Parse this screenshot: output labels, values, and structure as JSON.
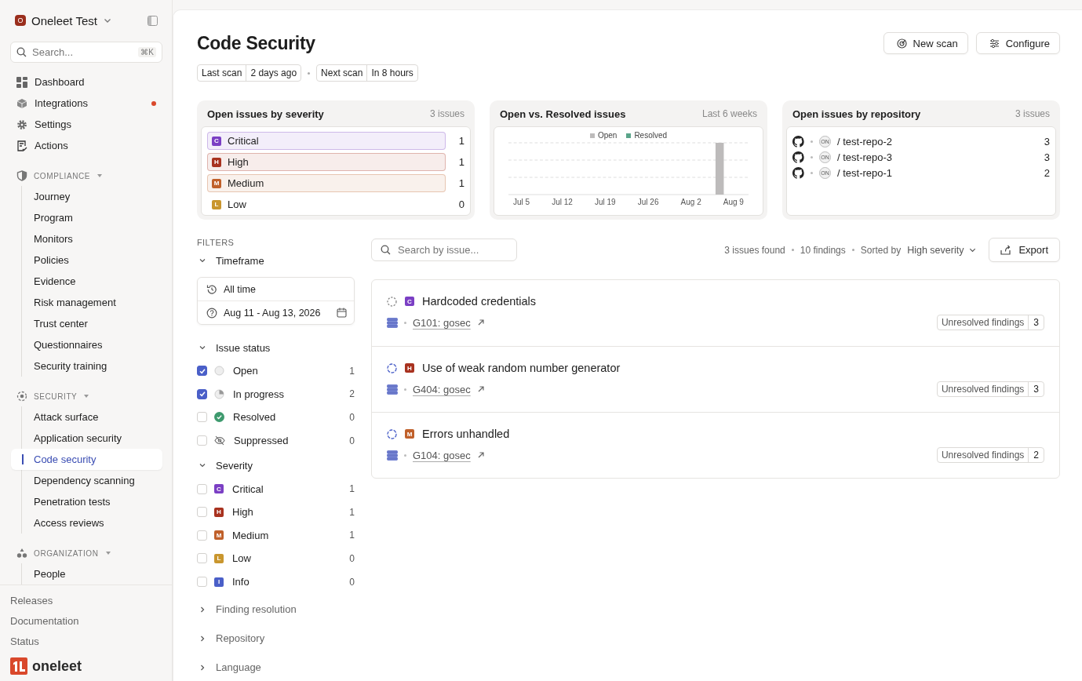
{
  "workspace": {
    "name": "Oneleet Test",
    "initial": "O"
  },
  "search": {
    "placeholder": "Search...",
    "shortcut": "⌘K"
  },
  "nav": [
    {
      "label": "Dashboard",
      "selected": false,
      "dot": false
    },
    {
      "label": "Integrations",
      "selected": false,
      "dot": true
    },
    {
      "label": "Settings",
      "selected": false,
      "dot": false
    },
    {
      "label": "Actions",
      "selected": false,
      "dot": false
    }
  ],
  "sections": [
    {
      "label": "COMPLIANCE",
      "expanded": true,
      "items": [
        {
          "label": "Journey",
          "selected": false
        },
        {
          "label": "Program",
          "selected": false
        },
        {
          "label": "Monitors",
          "selected": false
        },
        {
          "label": "Policies",
          "selected": false
        },
        {
          "label": "Evidence",
          "selected": false
        },
        {
          "label": "Risk management",
          "selected": false
        },
        {
          "label": "Trust center",
          "selected": false
        },
        {
          "label": "Questionnaires",
          "selected": false
        },
        {
          "label": "Security training",
          "selected": false
        }
      ]
    },
    {
      "label": "SECURITY",
      "expanded": true,
      "items": [
        {
          "label": "Attack surface",
          "selected": false
        },
        {
          "label": "Application security",
          "selected": false
        },
        {
          "label": "Code security",
          "selected": true
        },
        {
          "label": "Dependency scanning",
          "selected": false
        },
        {
          "label": "Penetration tests",
          "selected": false
        },
        {
          "label": "Access reviews",
          "selected": false
        }
      ]
    },
    {
      "label": "ORGANIZATION",
      "expanded": true,
      "items": [
        {
          "label": "People",
          "selected": false
        }
      ]
    }
  ],
  "footer_links": [
    "Releases",
    "Documentation",
    "Status"
  ],
  "brand": {
    "name": "oneleet"
  },
  "page": {
    "title": "Code Security",
    "actions": [
      "New scan",
      "Configure"
    ]
  },
  "scan_info": [
    {
      "label": "Last scan",
      "value": "2 days ago"
    },
    {
      "label": "Next scan",
      "value": "In 8 hours"
    }
  ],
  "severity_card": {
    "title": "Open issues by severity",
    "meta": "3 issues",
    "rows": [
      {
        "letter": "C",
        "label": "Critical",
        "count": "1",
        "color": "#7b3fc4",
        "highlighted": true
      },
      {
        "letter": "H",
        "label": "High",
        "count": "1",
        "color": "#a8321f",
        "highlighted": true
      },
      {
        "letter": "M",
        "label": "Medium",
        "count": "1",
        "color": "#c0602a",
        "highlighted": true
      },
      {
        "letter": "L",
        "label": "Low",
        "count": "0",
        "color": "#c9962e",
        "highlighted": false
      }
    ]
  },
  "trend_card": {
    "title": "Open vs. Resolved issues",
    "meta": "Last 6 weeks",
    "legend": [
      {
        "label": "Open",
        "color": "#bdbbbb"
      },
      {
        "label": "Resolved",
        "color": "#5aa58a"
      }
    ],
    "x_labels": [
      "Jul 5",
      "Jul 12",
      "Jul 19",
      "Jul 26",
      "Aug 2",
      "Aug 9"
    ]
  },
  "repo_card": {
    "title": "Open issues by repository",
    "meta": "3 issues",
    "repos": [
      {
        "owner": "ON",
        "name": "/ test-repo-2",
        "count": "3"
      },
      {
        "owner": "ON",
        "name": "/ test-repo-3",
        "count": "3"
      },
      {
        "owner": "ON",
        "name": "/ test-repo-1",
        "count": "2"
      }
    ]
  },
  "filters": {
    "heading": "FILTERS",
    "timeframe": {
      "label": "Timeframe",
      "expanded": true,
      "options": [
        "All time",
        "Aug 11 - Aug 13, 2026"
      ]
    },
    "issue_status": {
      "label": "Issue status",
      "expanded": true,
      "items": [
        {
          "kind": "open",
          "label": "Open",
          "count": "1",
          "checked": true
        },
        {
          "kind": "progress",
          "label": "In progress",
          "count": "2",
          "checked": true
        },
        {
          "kind": "resolved",
          "label": "Resolved",
          "count": "0",
          "checked": false
        },
        {
          "kind": "suppressed",
          "label": "Suppressed",
          "count": "0",
          "checked": false
        }
      ]
    },
    "severity": {
      "label": "Severity",
      "expanded": true,
      "items": [
        {
          "letter": "C",
          "label": "Critical",
          "count": "1",
          "checked": false,
          "color": "#7b3fc4"
        },
        {
          "letter": "H",
          "label": "High",
          "count": "1",
          "checked": false,
          "color": "#a8321f"
        },
        {
          "letter": "M",
          "label": "Medium",
          "count": "1",
          "checked": false,
          "color": "#c0602a"
        },
        {
          "letter": "L",
          "label": "Low",
          "count": "0",
          "checked": false,
          "color": "#c9962e"
        },
        {
          "letter": "I",
          "label": "Info",
          "count": "0",
          "checked": false,
          "color": "#4a5fc8"
        }
      ]
    },
    "collapsed": [
      {
        "label": "Finding resolution",
        "expanded": false
      },
      {
        "label": "Repository",
        "expanded": false
      },
      {
        "label": "Language",
        "expanded": false
      }
    ]
  },
  "toolbar": {
    "search_placeholder": "Search by issue...",
    "summary": [
      "3 issues found",
      "10 findings"
    ],
    "sort_label": "Sorted by",
    "sort_value": "High severity",
    "export": "Export"
  },
  "issues": [
    {
      "kind": "open",
      "letter": "C",
      "color": "#7b3fc4",
      "title": "Hardcoded credentials",
      "rule": "G101: gosec",
      "findings_label": "Unresolved findings",
      "findings": "3"
    },
    {
      "kind": "progress",
      "letter": "H",
      "color": "#a8321f",
      "title": "Use of weak random number generator",
      "rule": "G404: gosec",
      "findings_label": "Unresolved findings",
      "findings": "3"
    },
    {
      "kind": "progress",
      "letter": "M",
      "color": "#c0602a",
      "title": "Errors unhandled",
      "rule": "G104: gosec",
      "findings_label": "Unresolved findings",
      "findings": "2"
    }
  ]
}
